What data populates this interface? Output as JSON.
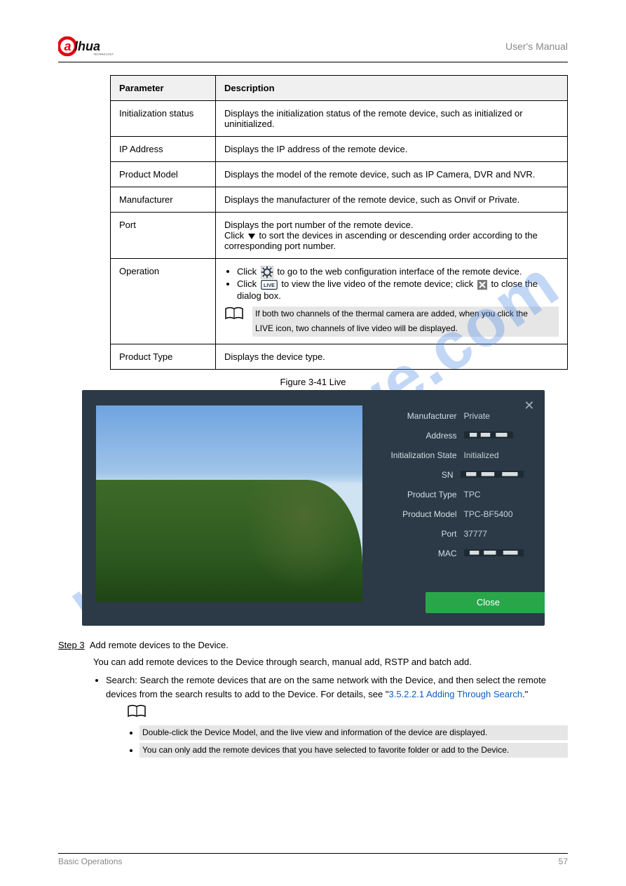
{
  "watermark": "manualshive.com",
  "header": {
    "title": "User's Manual"
  },
  "table": {
    "headParam": "Parameter",
    "headDesc": "Description",
    "rows": [
      {
        "param": "Initialization status",
        "desc": "Displays the initialization status of the remote device, such as initialized or uninitialized."
      },
      {
        "param": "IP Address",
        "desc": "Displays the IP address of the remote device."
      },
      {
        "param": "Product Model",
        "desc": "Displays the model of the remote device, such as IP Camera, DVR and NVR."
      },
      {
        "param": "Manufacturer",
        "desc": "Displays the manufacturer of the remote device, such as Onvif or Private."
      },
      {
        "param": "Port",
        "desc_pre": "Displays the port number of the remote device.",
        "desc_post": "Click ",
        "desc_post2": " to sort the devices in ascending or descending order according to the corresponding port number."
      },
      {
        "param": "Operation",
        "line1a": "Click ",
        "line1b": " to go to the web configuration interface of the remote device.",
        "line2a": "Click ",
        "line2b": " to view the live video of the remote device; click ",
        "line2c": " to close the dialog box.",
        "noteLine1": "If both two channels of the thermal camera are added, when you click the",
        "noteLine2": "LIVE icon, two channels of live video will be displayed."
      },
      {
        "param": "Product Type",
        "desc": "Displays the device type."
      }
    ]
  },
  "figure": {
    "caption": "Figure 3-41 Live"
  },
  "dialog": {
    "fields": {
      "Manufacturer": "Private",
      "Address": "",
      "Initialization State": "Initialized",
      "SN": "",
      "Product Type": "TPC",
      "Product Model": "TPC-BF5400",
      "Port": "37777",
      "MAC": ""
    },
    "close": "Close"
  },
  "step": {
    "label": "Step 3",
    "title": "Add remote devices to the Device.",
    "intro": "You can add remote devices to the Device through search, manual add, RSTP and batch add.",
    "bullet1a": "Search: Search the remote devices that are on the same network with the Device, and then select the remote devices from the search results to add to the Device. For details, see \"",
    "bullet1link": "3.5.2.2.1 Adding Through Search",
    "bullet1b": ".\"",
    "notes": [
      "Double-click the Device Model, and the live view and information of the device are displayed.",
      "You can only add the remote devices that you have selected to favorite folder or add to the Device."
    ]
  },
  "footer": {
    "left": "Basic Operations",
    "right": "57"
  },
  "icons": {
    "gear": "gear-icon",
    "live": "live-icon",
    "close": "close-icon",
    "tri": "sort-triangle-icon",
    "book": "note-book-icon"
  }
}
